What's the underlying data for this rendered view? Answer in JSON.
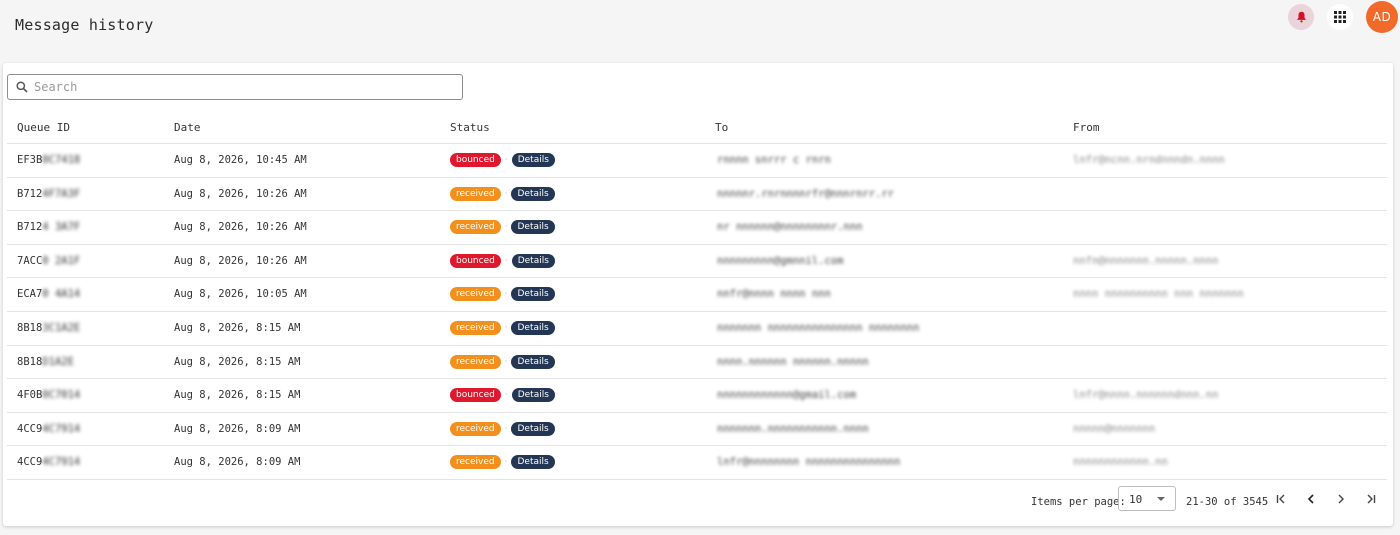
{
  "header": {
    "title": "Message history",
    "icons": {
      "bell": "bell-icon",
      "apps": "apps-grid-icon"
    },
    "avatar_initials": "AD"
  },
  "colors": {
    "bounced": "#e0182d",
    "received": "#f3901d",
    "details": "#233654",
    "avatar": "#f26a2a"
  },
  "search": {
    "placeholder": "Search",
    "value": ""
  },
  "table": {
    "columns": [
      "Queue ID",
      "Date",
      "Status",
      "To",
      "From"
    ],
    "details_label": "Details",
    "rows": [
      {
        "qid_prefix": "EF3B",
        "qid_tail": "0C7418",
        "date": "Aug 8, 2026, 10:45 AM",
        "status": "bounced",
        "to": "rnnnn snrrr c rnrn",
        "from": "lnfr@ncnn.nrndnnndn.nnnn"
      },
      {
        "qid_prefix": "B712",
        "qid_tail": "4F7A3F",
        "date": "Aug 8, 2026, 10:26 AM",
        "status": "received",
        "to": "nnnnnr.rnrnnnnrfr@nnnrnrr.rr",
        "from": ""
      },
      {
        "qid_prefix": "B712",
        "qid_tail": "4 3A7F",
        "date": "Aug 8, 2026, 10:26 AM",
        "status": "received",
        "to": "nr nnnnnn@nnnnnnnnr.nnn",
        "from": ""
      },
      {
        "qid_prefix": "7ACC",
        "qid_tail": "0 2A1F",
        "date": "Aug 8, 2026, 10:26 AM",
        "status": "bounced",
        "to": "nnnnnnnnn@gmnnil.com",
        "from": "nnfn@nnnnnnn.nnnnn.nnnn"
      },
      {
        "qid_prefix": "ECA7",
        "qid_tail": "0 4A14",
        "date": "Aug 8, 2026, 10:05 AM",
        "status": "received",
        "to": "nnfr@nnnn nnnn nnn",
        "from": "nnnn nnnnnnnnnn nnn nnnnnnn"
      },
      {
        "qid_prefix": "8B18",
        "qid_tail": "3C1A2E",
        "date": "Aug 8, 2026, 8:15 AM",
        "status": "received",
        "to": "nnnnnnn nnnnnnnnnnnnnnn nnnnnnnn",
        "from": ""
      },
      {
        "qid_prefix": "8B18",
        "qid_tail": "D1A2E",
        "date": "Aug 8, 2026, 8:15 AM",
        "status": "received",
        "to": "nnnn.nnnnnn nnnnnn.nnnnn",
        "from": ""
      },
      {
        "qid_prefix": "4F0B",
        "qid_tail": "0C7014",
        "date": "Aug 8, 2026, 8:15 AM",
        "status": "bounced",
        "to": "nnnnnnnnnnnn@gmail.com",
        "from": "lnfr@nnnn.nnnnnndnnn.nn"
      },
      {
        "qid_prefix": "4CC9",
        "qid_tail": "4C7914",
        "date": "Aug 8, 2026, 8:09 AM",
        "status": "received",
        "to": "nnnnnnn.nnnnnnnnnnn.nnnn",
        "from": "nnnnn@nnnnnnn"
      },
      {
        "qid_prefix": "4CC9",
        "qid_tail": "4C7914",
        "date": "Aug 8, 2026, 8:09 AM",
        "status": "received",
        "to": "lnfr@nnnnnnnn nnnnnnnnnnnnnnn",
        "from": "nnnnnnnnnnnn.nn"
      }
    ]
  },
  "pagination": {
    "items_per_page_label": "Items per page:",
    "items_per_page": "10",
    "range": "21-30 of 3545",
    "icons": [
      "first-page-icon",
      "previous-page-icon",
      "next-page-icon",
      "last-page-icon"
    ]
  }
}
